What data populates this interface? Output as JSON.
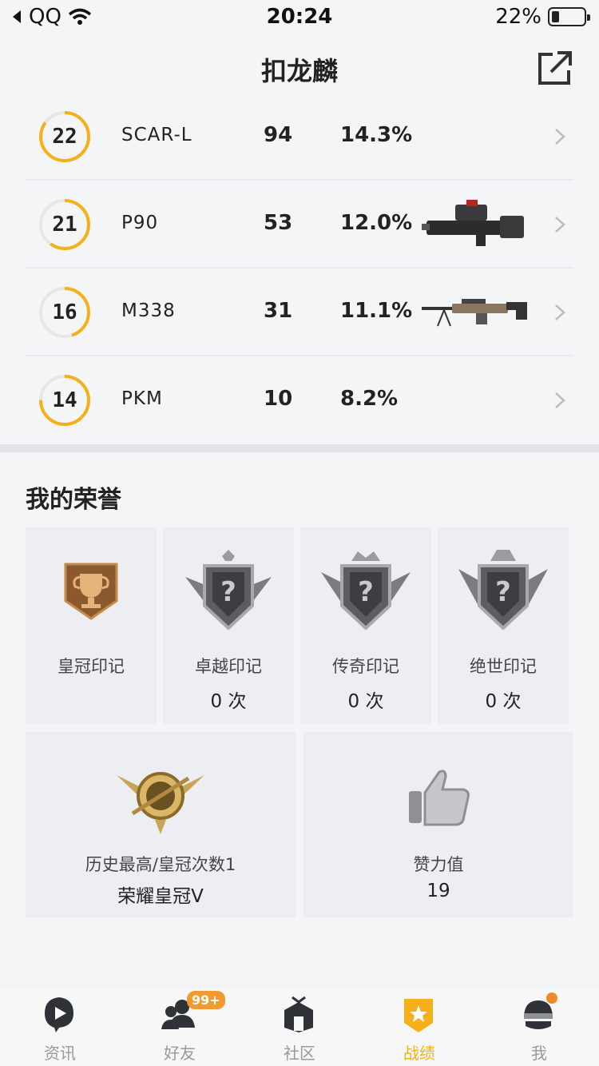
{
  "status_bar": {
    "carrier": "QQ",
    "time": "20:24",
    "battery_text": "22%",
    "battery_level": 0.22
  },
  "header": {
    "title": "扣龙麟"
  },
  "weapons": [
    {
      "rank": "22",
      "name": "SCAR-L",
      "count": "94",
      "percent": "14.3%",
      "ring_progress": 0.85,
      "has_image": false
    },
    {
      "rank": "21",
      "name": "P90",
      "count": "53",
      "percent": "12.0%",
      "ring_progress": 0.6,
      "has_image": true
    },
    {
      "rank": "16",
      "name": "M338",
      "count": "31",
      "percent": "11.1%",
      "ring_progress": 0.45,
      "has_image": true
    },
    {
      "rank": "14",
      "name": "PKM",
      "count": "10",
      "percent": "8.2%",
      "ring_progress": 0.75,
      "has_image": false
    }
  ],
  "honor": {
    "title": "我的荣誉",
    "marks": [
      {
        "label": "皇冠印记",
        "value": ""
      },
      {
        "label": "卓越印记",
        "value": "0 次"
      },
      {
        "label": "传奇印记",
        "value": "0 次"
      },
      {
        "label": "绝世印记",
        "value": "0 次"
      }
    ],
    "history": {
      "label": "历史最高/皇冠次数1",
      "value": "荣耀皇冠Ⅴ"
    },
    "likes": {
      "label": "赞力值",
      "value": "19"
    }
  },
  "nav": [
    {
      "label": "资讯",
      "icon": "news-icon"
    },
    {
      "label": "好友",
      "icon": "friends-icon",
      "badge": "99+"
    },
    {
      "label": "社区",
      "icon": "community-icon"
    },
    {
      "label": "战绩",
      "icon": "record-icon",
      "active": true
    },
    {
      "label": "我",
      "icon": "profile-icon",
      "dot": true
    }
  ],
  "colors": {
    "accent": "#f5b01a",
    "ring_track": "#e6e6e6"
  }
}
